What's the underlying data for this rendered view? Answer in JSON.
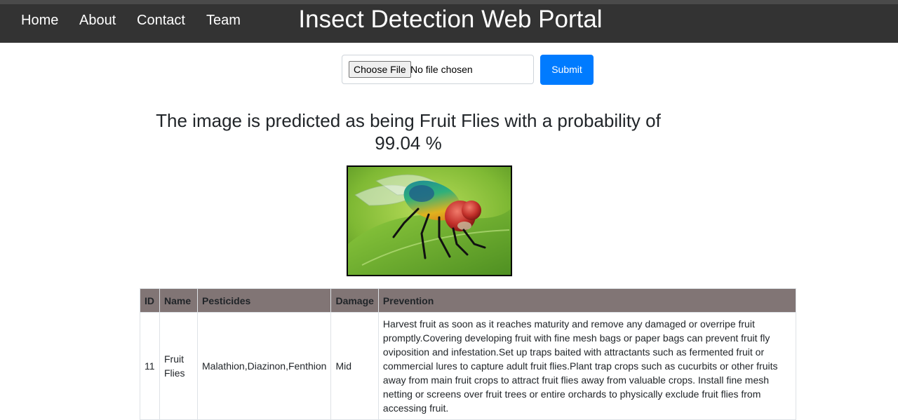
{
  "nav": {
    "items": [
      {
        "label": "Home"
      },
      {
        "label": "About"
      },
      {
        "label": "Contact"
      },
      {
        "label": "Team"
      }
    ],
    "title": "Insect Detection Web Portal"
  },
  "upload": {
    "button_label": "Choose File",
    "status": "No file chosen",
    "submit_label": "Submit"
  },
  "result": {
    "prediction_text": "The image is predicted as being Fruit Flies with a probability of 99.04 %",
    "image_icon": "fly-photo"
  },
  "table": {
    "headers": [
      "ID",
      "Name",
      "Pesticides",
      "Damage",
      "Prevention"
    ],
    "rows": [
      {
        "id": "11",
        "name": "Fruit Flies",
        "pesticides": "Malathion,Diazinon,Fenthion",
        "damage": "Mid",
        "prevention": "Harvest fruit as soon as it reaches maturity and remove any damaged or overripe fruit promptly.Covering developing fruit with fine mesh bags or paper bags can prevent fruit fly oviposition and infestation.Set up traps baited with attractants such as fermented fruit or commercial lures to capture adult fruit flies.Plant trap crops such as cucurbits or other fruits away from main fruit crops to attract fruit flies away from valuable crops. Install fine mesh netting or screens over fruit trees or entire orchards to physically exclude fruit flies from accessing fruit."
      }
    ]
  },
  "colors": {
    "navbar": "#333333",
    "submit": "#007bff",
    "table_header": "#817575"
  }
}
